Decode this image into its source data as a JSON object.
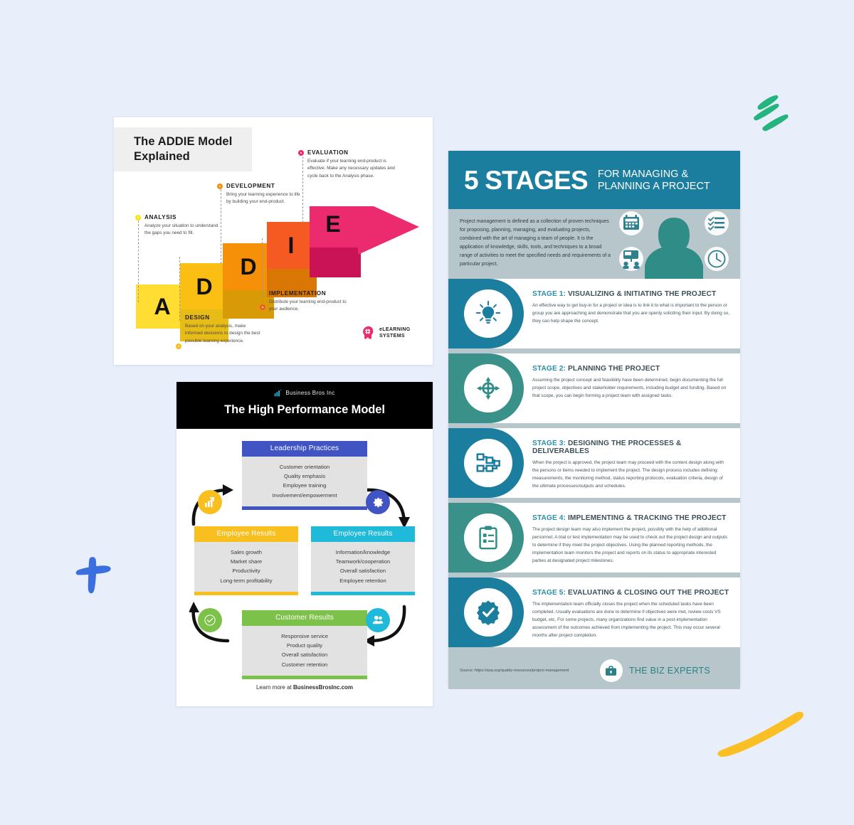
{
  "canvas": {
    "background": "#e9eefb"
  },
  "doodles": {
    "green_strokes": {
      "name": "green-brush-strokes",
      "color": "#24b47e"
    },
    "blue_plus": {
      "name": "blue-brush-plus",
      "color": "#3b6fe0"
    },
    "yellow_swoosh": {
      "name": "yellow-brush-swoosh",
      "color": "#f9bf24"
    }
  },
  "addie": {
    "title": "The ADDIE Model\nExplained",
    "title_line1": "The ADDIE Model",
    "title_line2": "Explained",
    "letters": [
      {
        "letter": "A",
        "color": "#ffdd33",
        "shadow": "#e8bc16"
      },
      {
        "letter": "D",
        "color": "#fbbe13",
        "shadow": "#d99a07"
      },
      {
        "letter": "D",
        "color": "#f79009",
        "shadow": "#d97604"
      },
      {
        "letter": "I",
        "color": "#f55a22",
        "shadow": "#d8410e"
      },
      {
        "letter": "E",
        "color": "#ec2a6e",
        "shadow": "#c91356"
      }
    ],
    "callouts": [
      {
        "key": "analysis",
        "title": "ANALYSIS",
        "body": "Analyze your situation to understand the gaps you need to fill.",
        "dot_color": "#f5e31c"
      },
      {
        "key": "design",
        "title": "DESIGN",
        "body": "Based on your analysis, make informed decisions to design the best possible learning experience.",
        "dot_color": "#fbbe13"
      },
      {
        "key": "development",
        "title": "DEVELOPMENT",
        "body": "Bring your learning experience to life by building your end-product.",
        "dot_color": "#f79009"
      },
      {
        "key": "implementation",
        "title": "IMPLEMENTATION",
        "body": "Distribute your learning end-product to your audience.",
        "dot_color": "#f55a22"
      },
      {
        "key": "evaluation",
        "title": "EVALUATION",
        "body": "Evaluate if your learning end-product is effective. Make any necessary updates and cycle back to the Analysis phase.",
        "dot_color": "#ec2a6e"
      }
    ],
    "logo": {
      "icon": "head-gear-icon",
      "line1": "eLEARNING",
      "line2": "SYSTEMS",
      "color": "#ec2a6e"
    }
  },
  "hpm": {
    "brand": {
      "icon": "bar-chart-icon",
      "name": "Business Bros Inc",
      "icon_color": "#1fb9d9"
    },
    "title": "The High Performance Model",
    "boxes": [
      {
        "key": "leadership",
        "heading": "Leadership Practices",
        "header_color": "#4054c4",
        "items": [
          "Customer orientation",
          "Quality emphasis",
          "Employee training",
          "Involvement/empowerment"
        ]
      },
      {
        "key": "employee_results_left",
        "heading": "Employee Results",
        "header_color": "#f9bf1f",
        "items": [
          "Sales growth",
          "Market share",
          "Productivity",
          "Long-term profitability"
        ]
      },
      {
        "key": "employee_results_right",
        "heading": "Employee Results",
        "header_color": "#1fb9d9",
        "items": [
          "Information/knowledge",
          "Teamwork/cooperation",
          "Overall satisfaction",
          "Employee retention"
        ]
      },
      {
        "key": "customer_results",
        "heading": "Customer Results",
        "header_color": "#7cc14a",
        "items": [
          "Responsive service",
          "Product quality",
          "Overall satisfaction",
          "Customer retention"
        ]
      }
    ],
    "icons": [
      {
        "name": "chart-growth-icon",
        "color": "#f9bf1f"
      },
      {
        "name": "gear-icon",
        "color": "#4054c4"
      },
      {
        "name": "check-circle-icon",
        "color": "#7cc14a"
      },
      {
        "name": "users-icon",
        "color": "#1fb9d9"
      }
    ],
    "footer_prefix": "Learn more at ",
    "footer_link": "BusinessBrosInc.com"
  },
  "stages": {
    "header": {
      "number": "5 STAGES",
      "sub_line1": "FOR MANAGING &",
      "sub_line2": "PLANNING A PROJECT",
      "bg": "#1b7e9e"
    },
    "intro": "Project management is defined as a collection of proven techniques for proposing, planning, managing, and evaluating projects, combined with the art of managing a team of people. It is the application of knowledge, skills, tools, and techniques to a broad range of activities to meet the specified needs and requirements of a particular project.",
    "intro_icons": [
      "calendar-icon",
      "checklist-icon",
      "presentation-team-icon",
      "clock-icon"
    ],
    "items": [
      {
        "num": "STAGE 1:",
        "name": "VISUALIZING & INITIATING THE PROJECT",
        "desc": "An effective way to get buy-in for a project or idea is to link it to what is important to the person or group you are approaching and demonstrate that you are openly soliciting their input. By doing so, they can help shape the concept.",
        "icon": "lightbulb-icon",
        "color": "#1b7e9e"
      },
      {
        "num": "STAGE 2:",
        "name": "PLANNING THE PROJECT",
        "desc": "Assuming the project concept and feasibility have been determined, begin documenting the full project scope, objectives and stakeholder requirements, including budget and funding. Based on that scope, you can begin forming a project team with assigned tasks.",
        "icon": "target-crosshair-icon",
        "color": "#3a9189"
      },
      {
        "num": "STAGE 3:",
        "name": "DESIGNING THE PROCESSES & DELIVERABLES",
        "desc": "When the project is approved, the project team may proceed with the content design along with the persons or items needed to implement the project. The design process includes defining: measurements, the monitoring method, status reporting protocols, evaluation criteria, design of the ultimate processes/outputs and schedules.",
        "icon": "flowchart-icon",
        "color": "#1b7e9e"
      },
      {
        "num": "STAGE 4:",
        "name": "IMPLEMENTING & TRACKING THE PROJECT",
        "desc": "The project design team may also implement the project, possibly with the help of additional personnel. A trial or test implementation may be used to check out the project design and outputs to determine if they meet the project objectives. Using the planned reporting methods, the implementation team monitors the project and reports on its status to appropriate interested parties at designated project milestones.",
        "icon": "clipboard-icon",
        "color": "#3a9189"
      },
      {
        "num": "STAGE 5:",
        "name": "EVALUATING & CLOSING OUT THE PROJECT",
        "desc": "The implementation team officially closes the project when the scheduled tasks have been completed. Usually evaluations are done to determine if objectives were met, review costs VS budget, etc. For some projects, many organizations find value in a post-implementation assessment of the outcomes achieved from implementing the project. This may occur several months after project completion.",
        "icon": "badge-check-icon",
        "color": "#1b7e9e"
      }
    ],
    "footer": {
      "source": "Source: https://asq.org/quality-resources/project-management",
      "brand_icon": "briefcase-icon",
      "brand_name": "THE BIZ EXPERTS"
    }
  }
}
